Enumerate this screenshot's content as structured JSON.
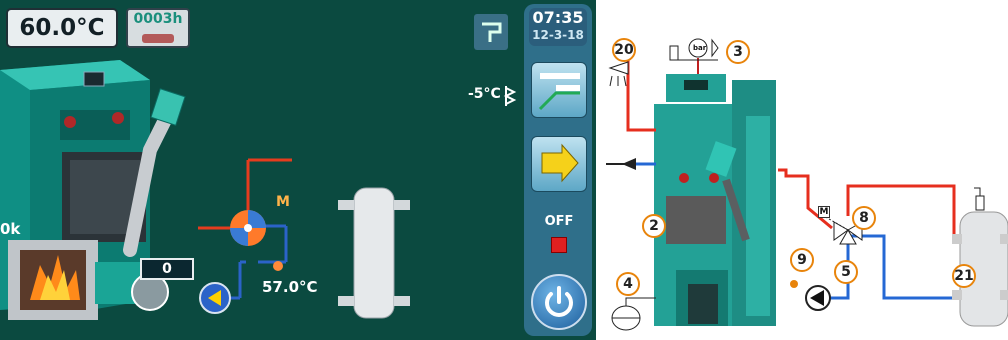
{
  "hmi": {
    "boiler_temperature": "60.0°C",
    "operating_hours": "0003h",
    "time": "07:35",
    "date": "12-3-18",
    "outdoor_temperature": "-5°C",
    "set_value": "0",
    "sensor_temperature": "57.0°C",
    "valve_label": "M",
    "left_label": "0k",
    "status": "OFF",
    "colors": {
      "background": "#0b4a40",
      "panel": "#2f6f8a",
      "status_off": "#e02020",
      "flow": "#e63c1e",
      "return": "#2b63c8"
    }
  },
  "schematic": {
    "callouts": [
      "20",
      "3",
      "2",
      "4",
      "8",
      "9",
      "5",
      "21"
    ],
    "pressure_label": "bar",
    "valve_motor_label": "M"
  }
}
